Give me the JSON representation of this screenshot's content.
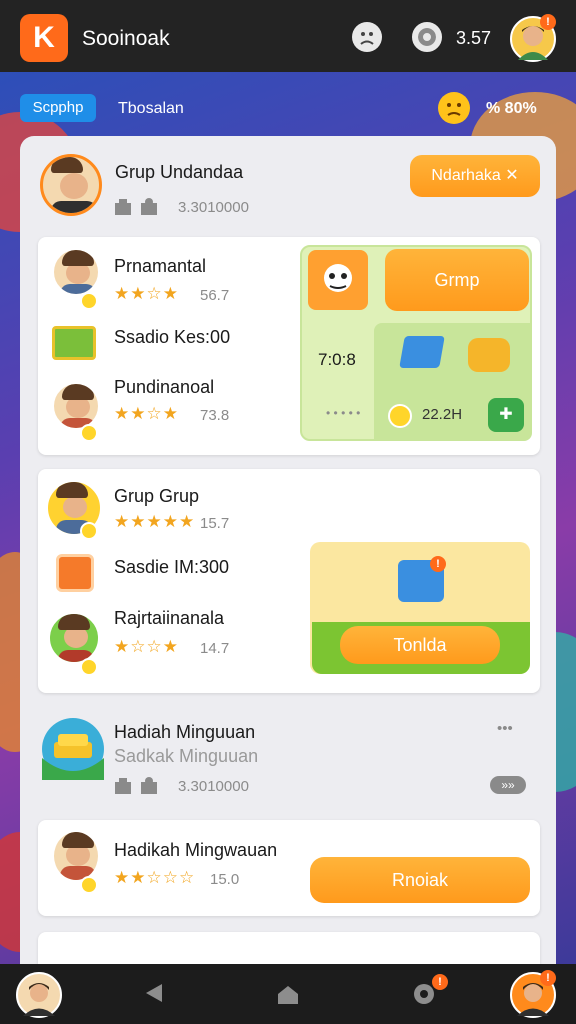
{
  "topbar": {
    "logo_letter": "K",
    "app_name": "Sooinoak",
    "coins": "3.57",
    "avatar_badge": "!"
  },
  "subbar": {
    "tab_label": "Scpphp",
    "secondary_label": "Tbosalan",
    "percent": "% 80%"
  },
  "header_card": {
    "title": "Grup Undandaa",
    "count": "3.3010000",
    "button_label": "Ndarhaka",
    "close_glyph": "✕"
  },
  "group1": {
    "rows": [
      {
        "name": "Prnamantal",
        "stars": "★★☆★",
        "score": "56.7"
      },
      {
        "name": "Ssadio Kes:00"
      },
      {
        "name": "Pundinanoal",
        "stars": "★★☆★",
        "score": "73.8"
      }
    ],
    "panel_button": "Grmp",
    "timer": "7:0:8",
    "dots": "• • • • •",
    "reward": "22.2H",
    "plus": "✚"
  },
  "group2": {
    "rows": [
      {
        "name": "Grup Grup",
        "stars": "★★★★★",
        "score": "15.7"
      },
      {
        "name": "Sasdie IM:300"
      },
      {
        "name": "Rajrtaiinanala",
        "stars": "★☆☆★",
        "score": "14.7"
      }
    ],
    "panel_button": "Tonlda"
  },
  "weekly": {
    "title": "Hadiah Minguuan",
    "subtitle": "Sadkak Minguuan",
    "count": "3.3010000",
    "more": "•••",
    "pill": "»»"
  },
  "weekly2": {
    "title": "Hadikah Mingwauan",
    "stars": "★★☆☆☆",
    "score": "15.0",
    "button_label": "Rnoiak"
  },
  "colors": {
    "accent_orange": "#ff9a1c",
    "accent_blue": "#1f8ee8",
    "accent_green": "#7cc532",
    "star_gold": "#f2a51f"
  }
}
